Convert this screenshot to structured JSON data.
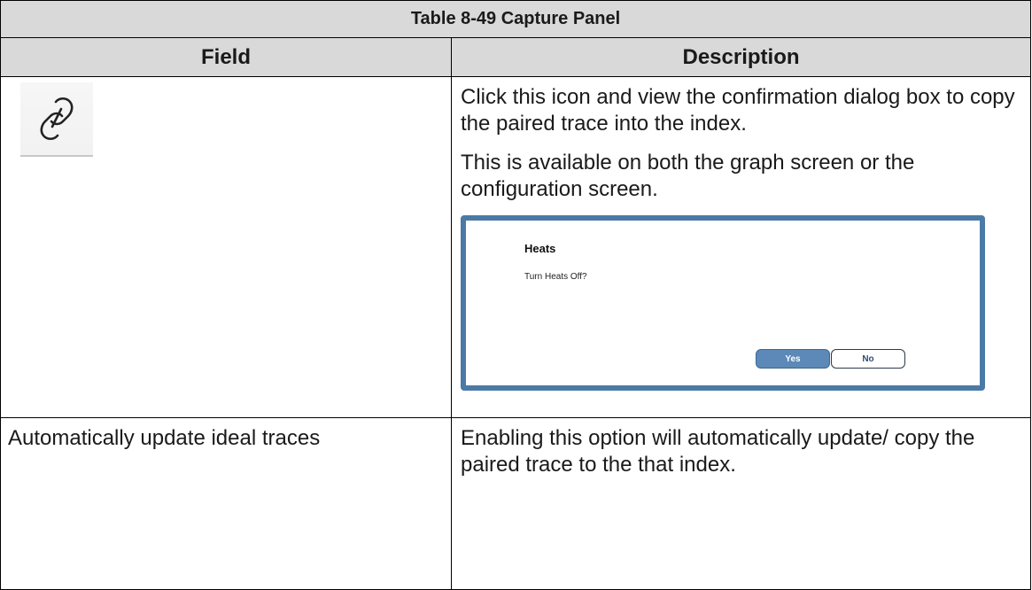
{
  "table": {
    "caption": "Table 8-49 Capture Panel",
    "headers": {
      "field": "Field",
      "description": "Description"
    },
    "rows": [
      {
        "field_icon": "link-icon",
        "description_paragraphs": [
          "Click this icon and view the confirmation dialog box to copy the paired trace into the index.",
          "This is available on both the graph screen or the configuration screen."
        ],
        "dialog": {
          "title": "Heats",
          "message": "Turn Heats Off?",
          "yes_label": "Yes",
          "no_label": "No"
        }
      },
      {
        "field": "Automatically update ideal traces",
        "description_paragraphs": [
          "Enabling this option will automatically update/ copy the paired trace to the that index."
        ]
      }
    ]
  },
  "colors": {
    "header_bg": "#d9d9d9",
    "dialog_border": "#4c7aa6",
    "yes_button": "#5c89b8"
  }
}
